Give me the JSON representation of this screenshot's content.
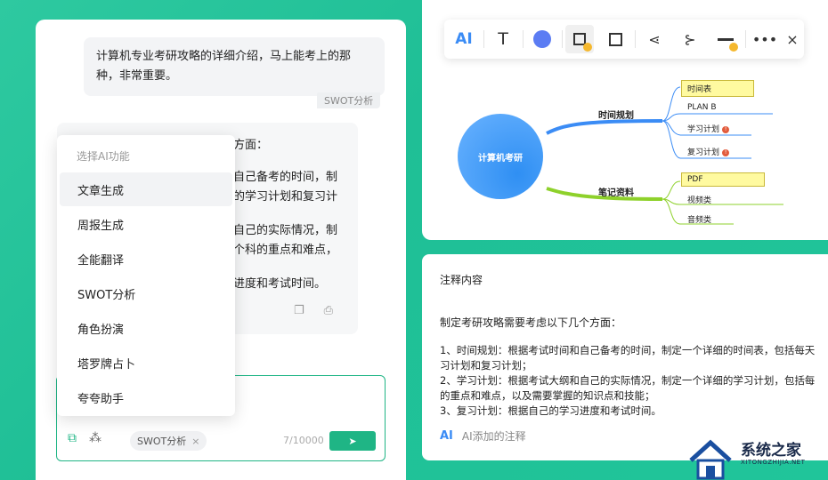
{
  "chat": {
    "user_message_1": "计算机专业考研攻略的详细介绍，马上能考上的那",
    "user_message_2": "种，非常重要。",
    "swot_tag": "SWOT分析",
    "ai_lines": [
      "方面：",
      "自己备考的时间，制",
      "的学习计划和复习计",
      "自己的实际情况，制",
      "个科的重点和难点，",
      "进度和考试时间。"
    ],
    "input_chip": "SWOT分析",
    "char_count": "7/10000"
  },
  "menu": {
    "header": "选择AI功能",
    "items": [
      "文章生成",
      "周报生成",
      "全能翻译",
      "SWOT分析",
      "角色扮演",
      "塔罗牌占卜",
      "夸夸助手"
    ],
    "selected_index": 0
  },
  "toolbar": {
    "ai_label": "AI",
    "text_icon": "T",
    "color": "#5b7cf3",
    "close": "×"
  },
  "mindmap": {
    "center": "计算机考研",
    "branch1": "时间规划",
    "branch1_children": [
      "时间表",
      "PLAN B",
      "学习计划",
      "复习计划"
    ],
    "branch2": "笔记资料",
    "branch2_children": [
      "PDF",
      "视频类",
      "音频类"
    ]
  },
  "note": {
    "title": "注释内容",
    "intro": "制定考研攻略需要考虑以下几个方面：",
    "lines": [
      "1、时间规划：根据考试时间和自己备考的时间，制定一个详细的时间表，包括每天",
      "习计划和复习计划；",
      "2、学习计划：根据考试大纲和自己的实际情况，制定一个详细的学习计划，包括每",
      "的重点和难点，以及需要掌握的知识点和技能；",
      "3、复习计划：根据自己的学习进度和考试时间。"
    ],
    "footer_ai": "AI",
    "footer_text": "AI添加的注释"
  },
  "logo": {
    "name": "系统之家",
    "sub": "XITONGZHIJIA.NET"
  }
}
